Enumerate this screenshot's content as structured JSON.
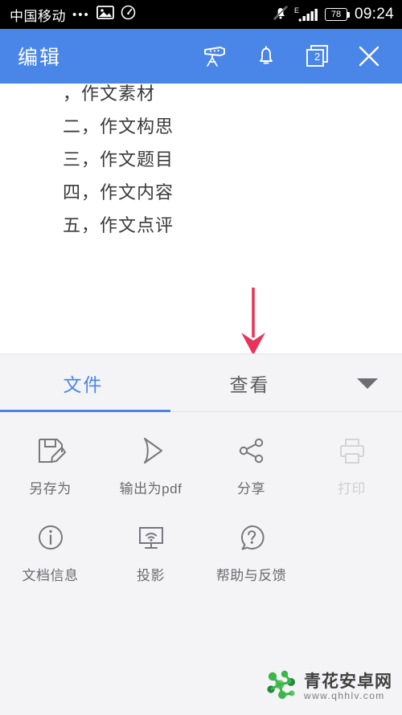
{
  "status_bar": {
    "carrier": "中国移动",
    "dots": "•••",
    "icons": [
      "image-icon",
      "gauge-icon",
      "bell-muted-icon",
      "signal-bars-icon"
    ],
    "network_type": "E",
    "battery_level": "78",
    "time": "09:24",
    "background_color": "#000000",
    "text_color": "#ffffff"
  },
  "app_bar": {
    "title": "编辑",
    "background_color": "#4a86e8",
    "actions": [
      {
        "name": "projector-icon",
        "label": "投影"
      },
      {
        "name": "bell-icon",
        "label": "通知"
      },
      {
        "name": "windows-icon",
        "label": "窗口",
        "badge": "2"
      },
      {
        "name": "close-icon",
        "label": "关闭"
      }
    ]
  },
  "document": {
    "lines": [
      "，作文素材",
      "二，作文构思",
      "三，作文题目",
      "四，作文内容",
      "五，作文点评"
    ]
  },
  "annotation": {
    "type": "down-arrow",
    "color": "#e8345a"
  },
  "panel": {
    "background_color": "#f4f4f6",
    "tabs": [
      {
        "label": "文件",
        "active": true,
        "accent": "#4a86e8"
      },
      {
        "label": "查看",
        "active": false
      }
    ],
    "caret": "chevron-down-icon",
    "items": [
      {
        "label": "另存为",
        "icon": "save-as-icon",
        "disabled": false
      },
      {
        "label": "输出为pdf",
        "icon": "export-pdf-icon",
        "disabled": false
      },
      {
        "label": "分享",
        "icon": "share-icon",
        "disabled": false
      },
      {
        "label": "打印",
        "icon": "print-icon",
        "disabled": true
      },
      {
        "label": "文档信息",
        "icon": "info-icon",
        "disabled": false
      },
      {
        "label": "投影",
        "icon": "cast-screen-icon",
        "disabled": false
      },
      {
        "label": "帮助与反馈",
        "icon": "help-icon",
        "disabled": false
      }
    ]
  },
  "watermark": {
    "name": "青花安卓网",
    "url": "www.qhhlv.com",
    "logo_color": "#2fa84f"
  }
}
